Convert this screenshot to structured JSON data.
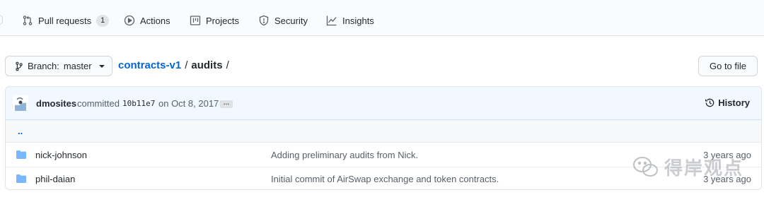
{
  "nav": {
    "pull_requests": "Pull requests",
    "pull_requests_count": "1",
    "actions": "Actions",
    "projects": "Projects",
    "security": "Security",
    "insights": "Insights"
  },
  "toolbar": {
    "branch_prefix": "Branch:",
    "branch": "master",
    "repo": "contracts-v1",
    "separator": "/",
    "folder": "audits",
    "go_to_file": "Go to file"
  },
  "commit": {
    "author": "dmosites",
    "verb": "committed",
    "sha": "10b11e7",
    "date": "on Oct 8, 2017",
    "ellipsis": "…",
    "history": "History"
  },
  "up_dir": "..",
  "files": [
    {
      "name": "nick-johnson",
      "message": "Adding preliminary audits from Nick.",
      "age": "3 years ago",
      "icon": "folder-icon"
    },
    {
      "name": "phil-daian",
      "message": "Initial commit of AirSwap exchange and token contracts.",
      "age": "3 years ago",
      "icon": "folder-icon"
    }
  ],
  "watermark": "得岸观点",
  "colors": {
    "link": "#0366d6",
    "folder": "#79b8ff",
    "commit_bg": "#f1f8ff",
    "border": "#e1e4e8"
  }
}
